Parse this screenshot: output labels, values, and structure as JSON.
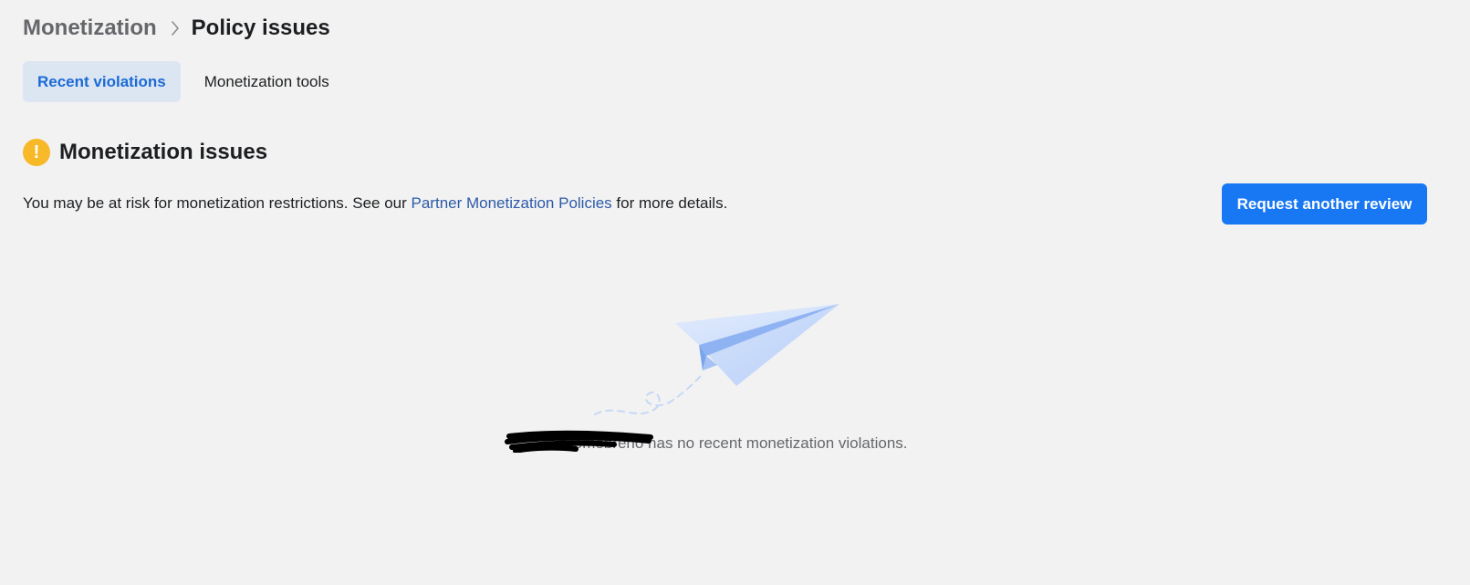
{
  "breadcrumb": {
    "parent": "Monetization",
    "current": "Policy issues"
  },
  "tabs": [
    {
      "label": "Recent violations",
      "active": true
    },
    {
      "label": "Monetization tools",
      "active": false
    }
  ],
  "section": {
    "title": "Monetization issues",
    "icon": "warning-icon",
    "description_prefix": "You may be at risk for monetization restrictions. See our ",
    "description_link": "Partner Monetization Policies",
    "description_suffix": " for more details."
  },
  "actions": {
    "request_review": "Request another review"
  },
  "empty_state": {
    "illustration": "paper-plane-icon",
    "message": "Homebreno has no recent monetization violations."
  },
  "colors": {
    "background": "#f2f2f2",
    "primary_button": "#1877f2",
    "link": "#2d5aa8",
    "active_tab_bg": "#dce6f3",
    "active_tab_text": "#1b6ad6",
    "warning": "#f7b928"
  }
}
